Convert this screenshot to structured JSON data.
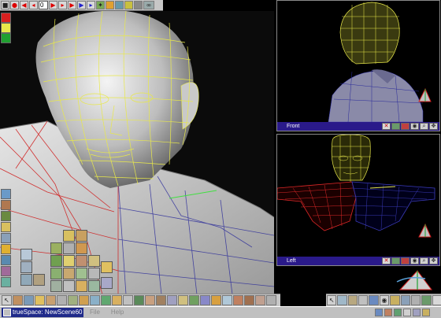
{
  "app": {
    "task_title": "trueSpace: NewScene60",
    "menu": [
      "File",
      "Help"
    ]
  },
  "toolbar": {
    "frame_value": "0"
  },
  "viewports": {
    "front_label": "Front",
    "left_label": "Left"
  },
  "icons": {
    "top": [
      "square-icon",
      "record-icon",
      "rewind-icon",
      "step-back-icon",
      "play-icon",
      "step-forward-icon",
      "fast-forward-icon",
      "render-icon",
      "scene-icon",
      "object-icon",
      "glasses-icon"
    ],
    "viewport_bar": [
      "close-icon",
      "grid-icon",
      "camera-icon",
      "eye-icon",
      "zoom-icon",
      "move-icon"
    ],
    "bottom": [
      "select-icon",
      "brush-icon",
      "object-icon",
      "sphere-icon",
      "cone-icon",
      "cylinder-icon",
      "lathe-icon",
      "sweep-icon",
      "deform-icon",
      "paint-icon",
      "material-icon",
      "light-icon",
      "camera-icon",
      "face-icon",
      "person-icon",
      "scene-icon",
      "render-icon",
      "tree-icon",
      "checker-icon",
      "torus-icon"
    ],
    "bottom_right": [
      "navigate-icon",
      "move-icon",
      "rotate-icon",
      "scale-icon",
      "view-icon",
      "eye-icon",
      "zoom-icon",
      "pan-icon",
      "orbit-icon",
      "grid-icon",
      "render-icon"
    ]
  },
  "colors": {
    "mesh_yellow": "#e8e84a",
    "mesh_red": "#e02828",
    "mesh_blue": "#3a3ab8",
    "viewport_bar": "#2a1a8a",
    "panel": "#c7c7c7"
  }
}
